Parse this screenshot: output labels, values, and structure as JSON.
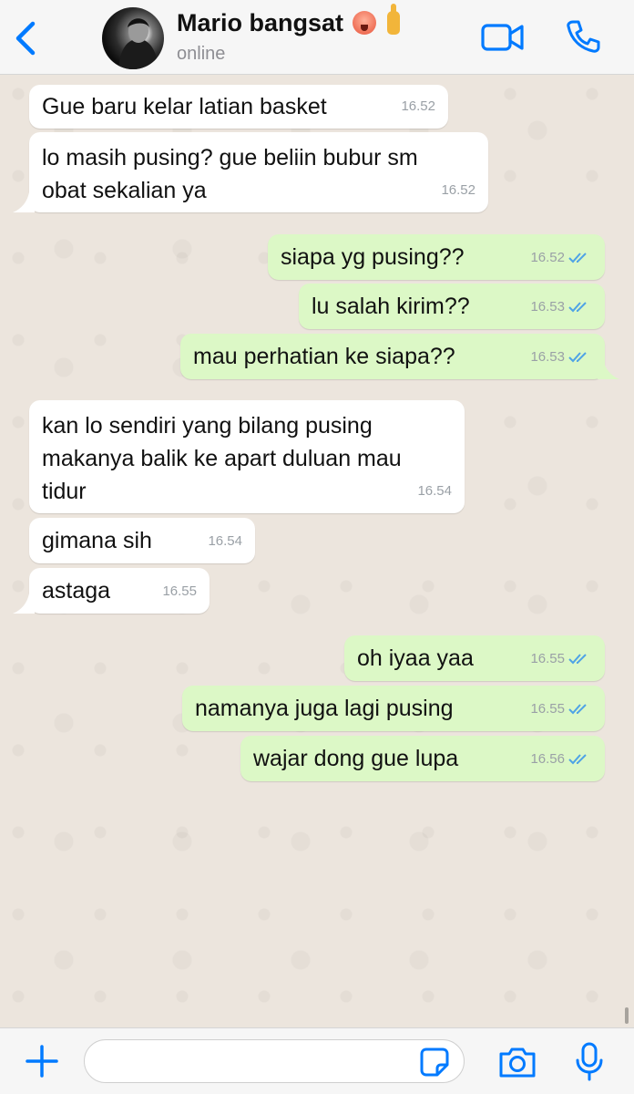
{
  "header": {
    "contact_name": "Mario bangsat",
    "status": "online",
    "name_emojis": [
      "hot-face-icon",
      "middle-finger-icon"
    ]
  },
  "colors": {
    "accent": "#007aff",
    "incoming_bubble": "#ffffff",
    "outgoing_bubble": "#dcf8c6",
    "read_ticks": "#4fa3e6",
    "chat_background": "#ece5dd"
  },
  "messages": [
    {
      "direction": "in",
      "text": "Gue baru kelar latian basket",
      "time": "16.52"
    },
    {
      "direction": "in",
      "text": "lo masih pusing? gue beliin bubur sm\nobat sekalian ya",
      "time": "16.52"
    },
    {
      "direction": "out",
      "text": "siapa yg pusing??",
      "time": "16.52",
      "read": true
    },
    {
      "direction": "out",
      "text": "lu salah kirim??",
      "time": "16.53",
      "read": true
    },
    {
      "direction": "out",
      "text": "mau perhatian ke siapa??",
      "time": "16.53",
      "read": true
    },
    {
      "direction": "in",
      "text": "kan lo sendiri yang bilang pusing\nmakanya balik ke apart duluan mau\ntidur",
      "time": "16.54"
    },
    {
      "direction": "in",
      "text": "gimana sih",
      "time": "16.54"
    },
    {
      "direction": "in",
      "text": "astaga",
      "time": "16.55"
    },
    {
      "direction": "out",
      "text": "oh iyaa yaa",
      "time": "16.55",
      "read": true
    },
    {
      "direction": "out",
      "text": "namanya juga lagi pusing",
      "time": "16.55",
      "read": true
    },
    {
      "direction": "out",
      "text": "wajar dong gue lupa",
      "time": "16.56",
      "read": true
    }
  ],
  "composer": {
    "placeholder": ""
  }
}
